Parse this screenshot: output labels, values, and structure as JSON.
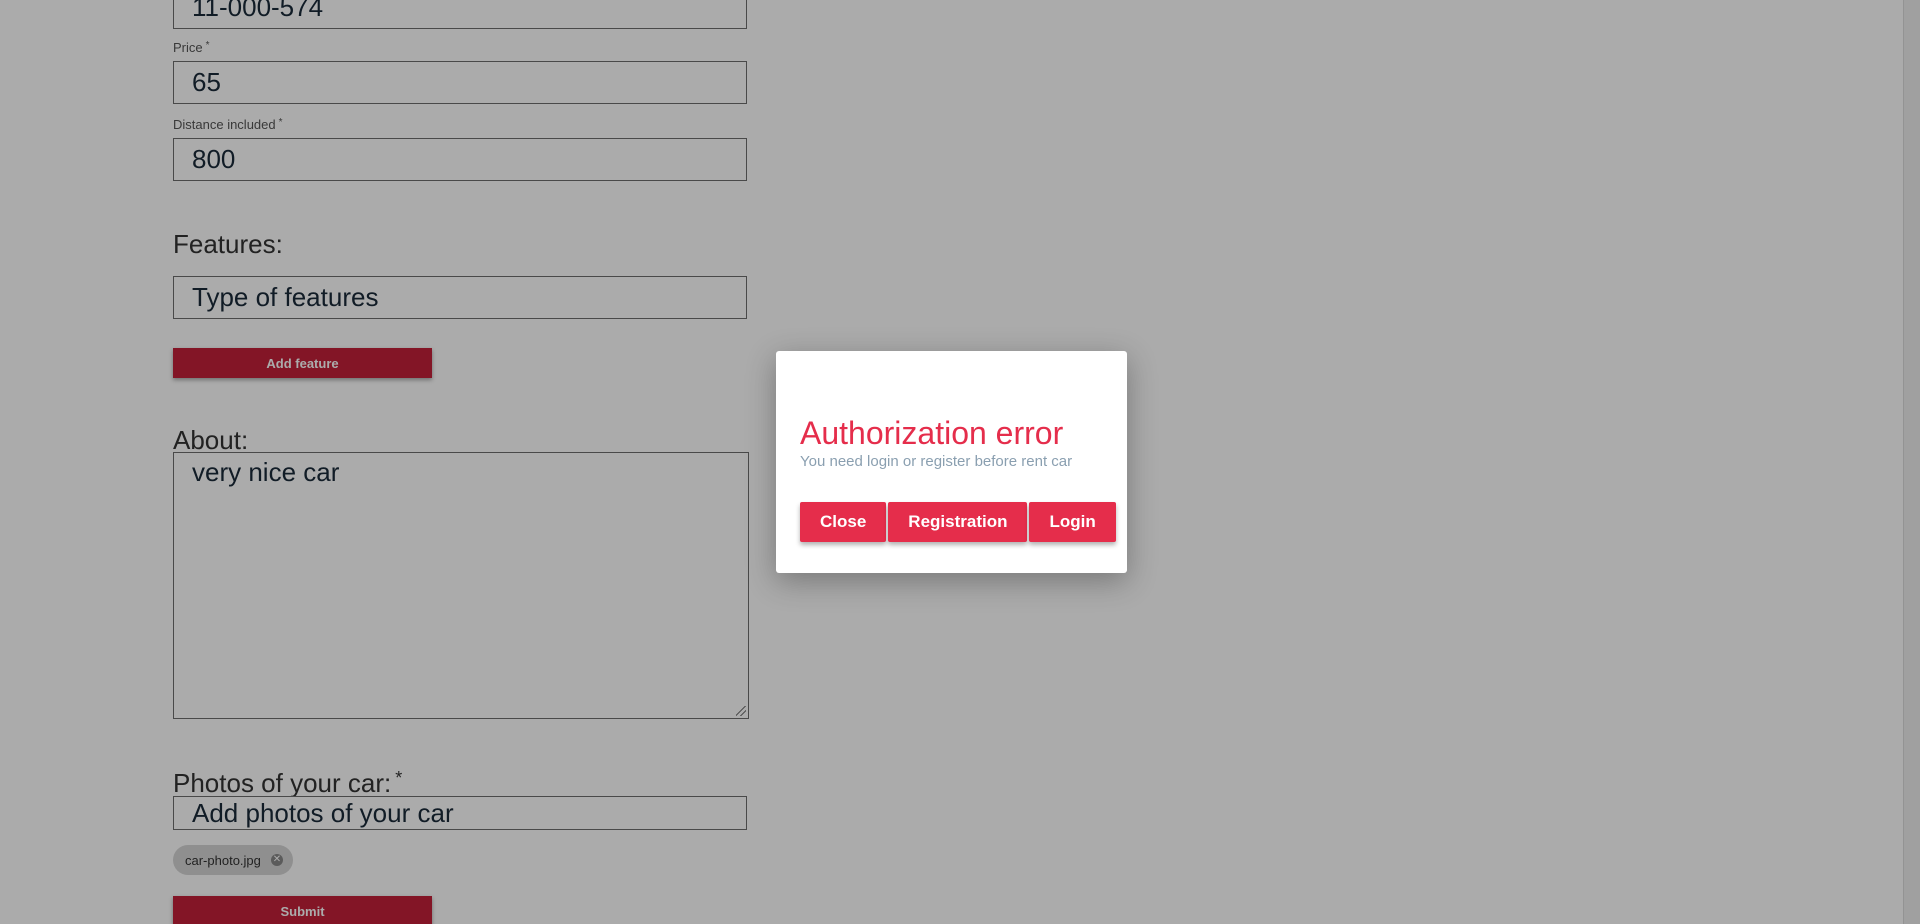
{
  "form": {
    "reg_number_value": "11-000-574",
    "price_label": "Price",
    "price_value": "65",
    "distance_label": "Distance included",
    "distance_value": "800",
    "required_mark": "*",
    "features_title": "Features:",
    "features_placeholder": "Type of features",
    "add_feature_label": "Add feature",
    "about_title": "About:",
    "about_value": "very nice car",
    "photos_title": "Photos of your car:",
    "photos_placeholder": "Add photos of your car",
    "photo_chip_label": "car-photo.jpg",
    "submit_label": "Submit"
  },
  "modal": {
    "title": "Authorization error",
    "subtitle": "You need login or register before rent car",
    "buttons": {
      "close": "Close",
      "registration": "Registration",
      "login": "Login"
    }
  },
  "colors": {
    "accent": "#e52d4b",
    "button_dark": "#c4203a",
    "overlay": "rgba(0,0,0,0.33)"
  }
}
